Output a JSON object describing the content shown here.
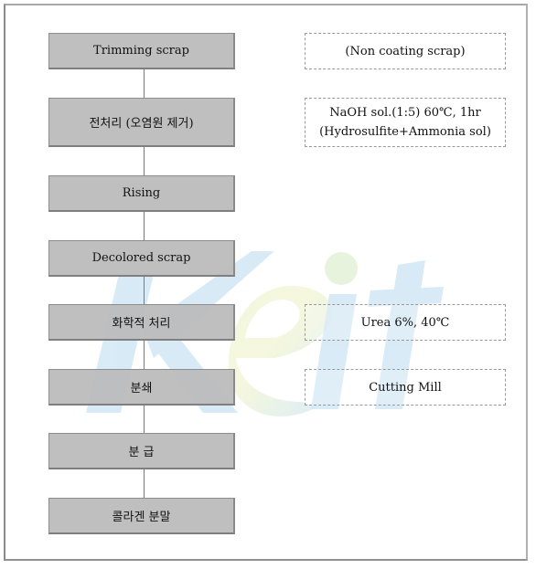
{
  "diagram": {
    "type": "process-flowchart",
    "steps": [
      {
        "label": "Trimming scrap"
      },
      {
        "label": "전처리 (오염원 제거)"
      },
      {
        "label": "Rising"
      },
      {
        "label": "Decolored scrap"
      },
      {
        "label": "화학적 처리"
      },
      {
        "label": "분쇄"
      },
      {
        "label": "분 급"
      },
      {
        "label": "콜라겐 분말"
      }
    ],
    "notes": [
      {
        "step": 0,
        "lines": [
          "(Non coating scrap)"
        ]
      },
      {
        "step": 1,
        "lines": [
          "NaOH sol.(1:5) 60℃, 1hr",
          "(Hydrosulfite+Ammonia sol)"
        ]
      },
      {
        "step": 4,
        "lines": [
          "Urea 6%, 40℃"
        ]
      },
      {
        "step": 5,
        "lines": [
          "Cutting Mill"
        ]
      }
    ]
  },
  "watermark": {
    "text": "Keit",
    "colors": {
      "primary": "#cfe6f5",
      "accent_green": "#e2f2d4",
      "accent_yellow": "#f4f7d6"
    }
  },
  "colors": {
    "step_fill": "#bababa",
    "step_border": "#8c8c8c",
    "note_border": "#9a9a9a",
    "connector": "#7a7a7a"
  }
}
